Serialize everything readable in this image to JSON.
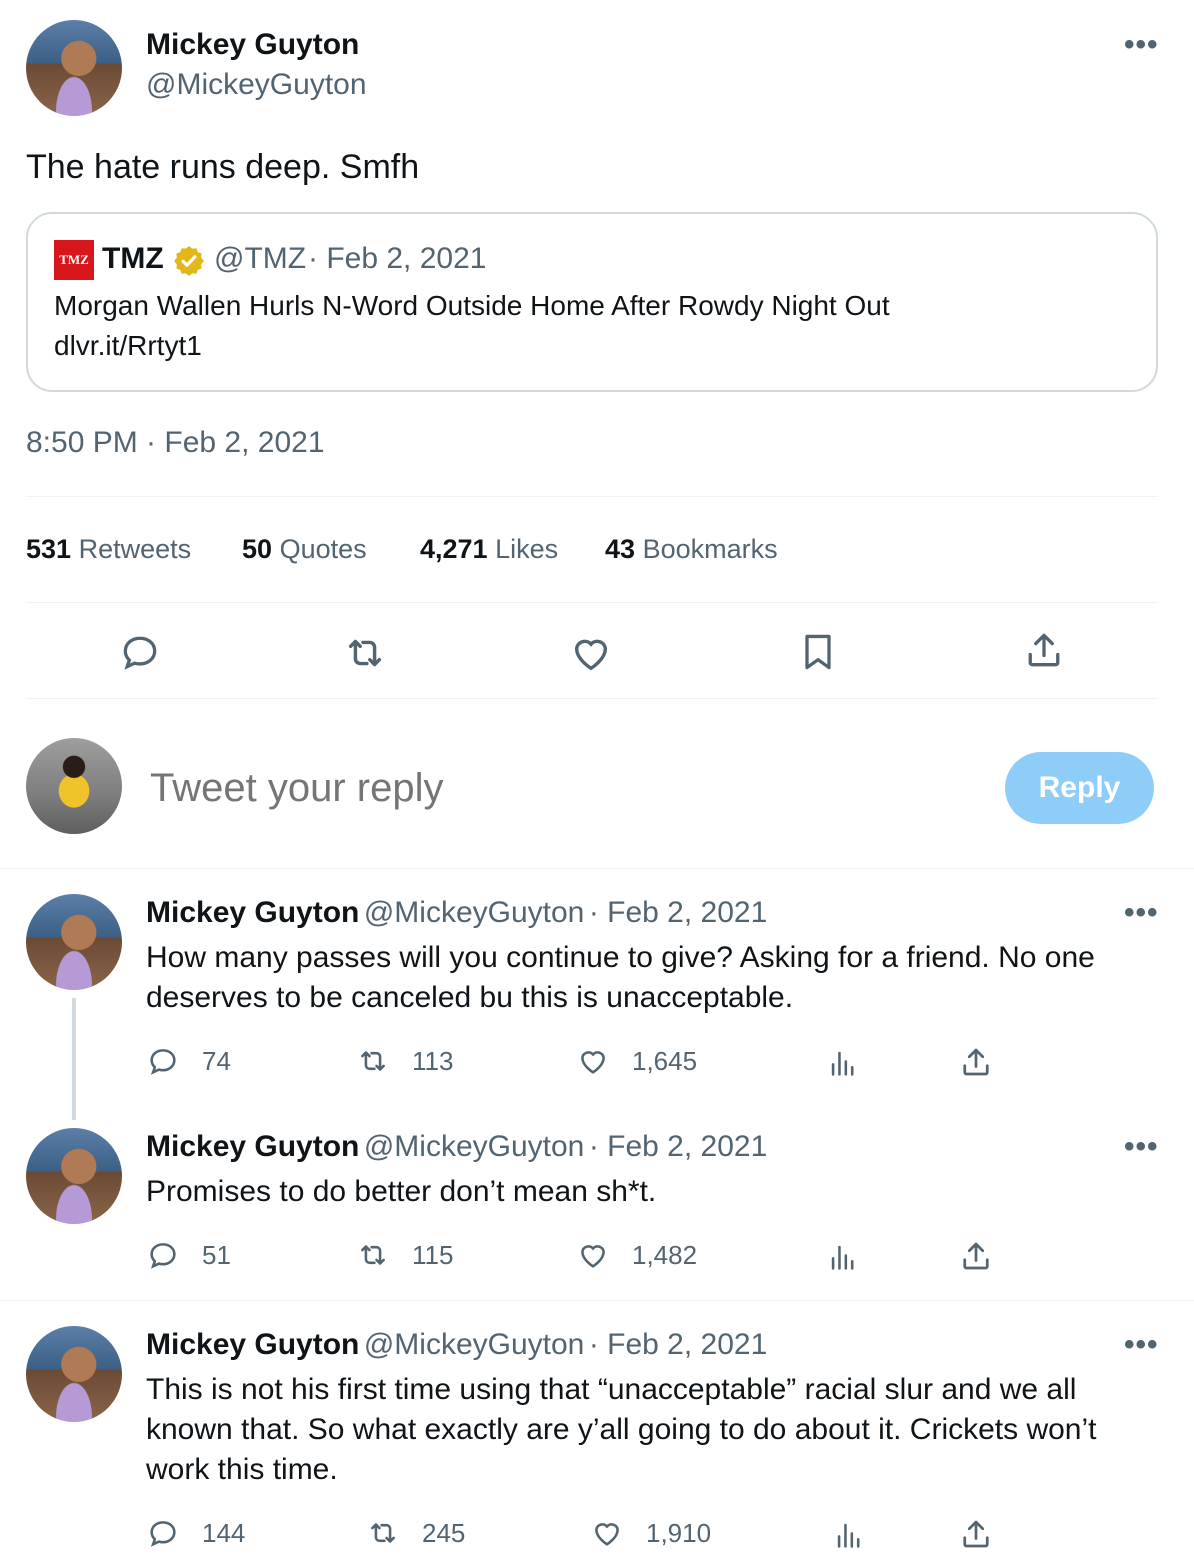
{
  "main_tweet": {
    "author_name": "Mickey Guyton",
    "author_handle": "@MickeyGuyton",
    "text": "The hate runs deep. Smfh",
    "timestamp": "8:50 PM · Feb 2, 2021",
    "more_icon": "•••",
    "quoted": {
      "logo_text": "TMZ",
      "name": "TMZ",
      "handle": "@TMZ",
      "date": "· Feb 2, 2021",
      "text": "Morgan Wallen Hurls N-Word Outside Home After Rowdy Night Out",
      "link": "dlvr.it/Rrtyt1"
    },
    "stats": [
      {
        "num": "531",
        "label": "Retweets"
      },
      {
        "num": "50",
        "label": "Quotes"
      },
      {
        "num": "4,271",
        "label": "Likes"
      },
      {
        "num": "43",
        "label": "Bookmarks"
      }
    ]
  },
  "reply_box": {
    "placeholder": "Tweet your reply",
    "button_label": "Reply"
  },
  "replies": [
    {
      "name": "Mickey Guyton",
      "handle": "@MickeyGuyton",
      "date": "· Feb 2, 2021",
      "text": "How many passes will you continue to give? Asking for a friend. No one deserves to be canceled bu this is unacceptable.",
      "replies": "74",
      "retweets": "113",
      "likes": "1,645"
    },
    {
      "name": "Mickey Guyton",
      "handle": "@MickeyGuyton",
      "date": "· Feb 2, 2021",
      "text": "Promises to do better don’t mean sh*t.",
      "replies": "51",
      "retweets": "115",
      "likes": "1,482"
    },
    {
      "name": "Mickey Guyton",
      "handle": "@MickeyGuyton",
      "date": "· Feb 2, 2021",
      "text": "This is not his first time using that “unacceptable” racial slur and we all known that. So what exactly are y’all going to do about it. Crickets won’t work this time.",
      "replies": "144",
      "retweets": "245",
      "likes": "1,910"
    }
  ],
  "colors": {
    "text_primary": "#0f1419",
    "text_secondary": "#536471",
    "reply_button_bg": "#8ecdf8",
    "verified_badge": "#e2b719",
    "tmz_logo": "#d8171c"
  }
}
